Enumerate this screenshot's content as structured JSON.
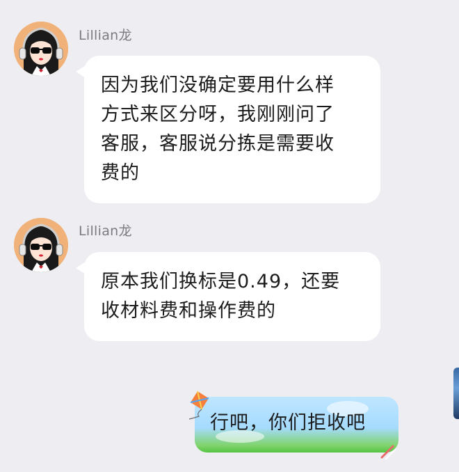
{
  "messages": [
    {
      "sender": "Lillian龙",
      "lines": [
        "因为我们没确定要用什么样",
        "方式来区分呀，我刚刚问了",
        "客服，客服说分拣是需要收",
        "费的"
      ]
    },
    {
      "sender": "Lillian龙",
      "lines": [
        "原本我们换标是0.49，还要",
        "收材料费和操作费的"
      ]
    }
  ],
  "outgoing": {
    "text": "行吧，你们拒收吧"
  },
  "colors": {
    "background": "#ededf2",
    "incoming_bubble": "#ffffff",
    "outgoing_bubble_top": "#bfe6ff",
    "outgoing_bubble_bottom": "#55c442",
    "avatar_bg": "#f0b278",
    "sender_text": "#7a7a80"
  }
}
